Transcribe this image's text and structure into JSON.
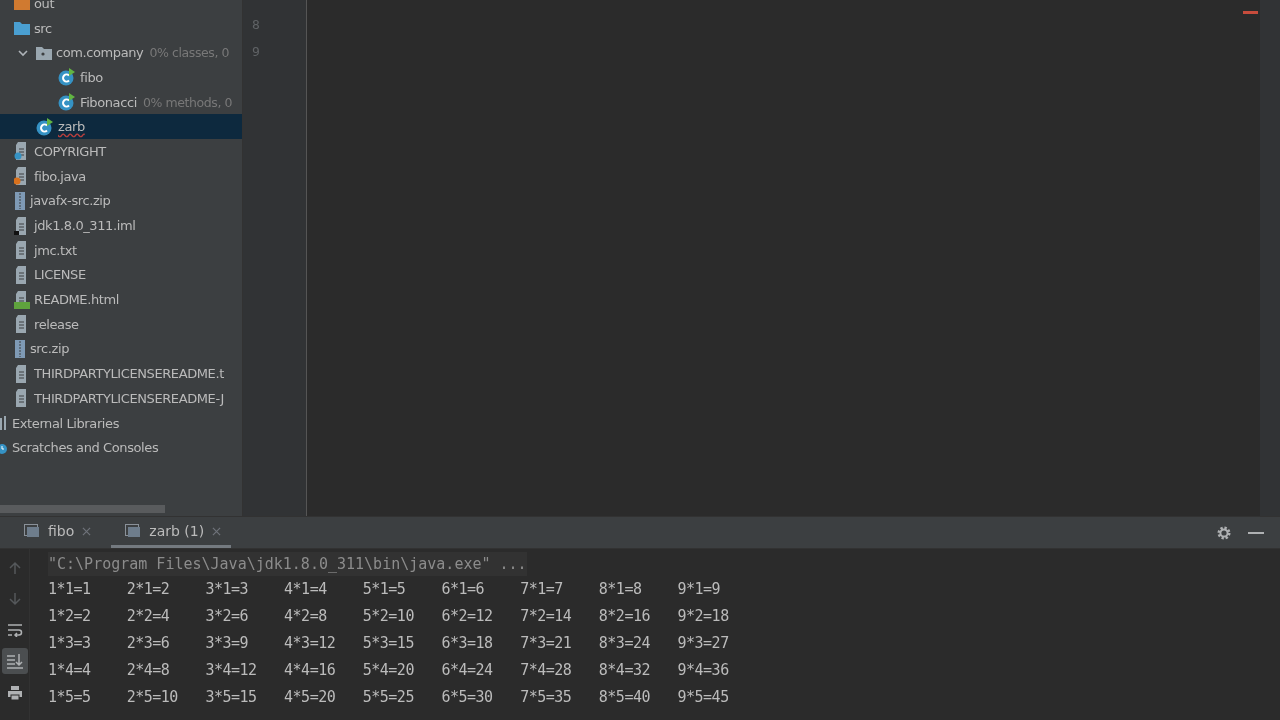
{
  "project_tree": {
    "items": [
      {
        "label": "out",
        "kind": "folder-orange",
        "selected": false
      },
      {
        "label": "src",
        "kind": "folder",
        "selected": false,
        "children": [
          {
            "label": "com.company",
            "kind": "package",
            "hint": "0% classes, 0",
            "expanded": true,
            "selected": false,
            "children": [
              {
                "label": "fibo",
                "kind": "class",
                "selected": false
              },
              {
                "label": "Fibonacci",
                "kind": "class",
                "hint": "0% methods, 0",
                "selected": false
              }
            ]
          },
          {
            "label": "zarb",
            "kind": "class",
            "selected": true
          }
        ]
      },
      {
        "label": "COPYRIGHT",
        "kind": "unknown-file",
        "selected": false
      },
      {
        "label": "fibo.java",
        "kind": "java-file",
        "selected": false
      },
      {
        "label": "javafx-src.zip",
        "kind": "zip",
        "selected": false
      },
      {
        "label": "jdk1.8.0_311.iml",
        "kind": "iml",
        "selected": false
      },
      {
        "label": "jmc.txt",
        "kind": "text",
        "selected": false
      },
      {
        "label": "LICENSE",
        "kind": "text",
        "selected": false
      },
      {
        "label": "README.html",
        "kind": "html",
        "selected": false
      },
      {
        "label": "release",
        "kind": "text",
        "selected": false
      },
      {
        "label": "src.zip",
        "kind": "zip",
        "selected": false
      },
      {
        "label": "THIRDPARTYLICENSEREADME.t",
        "kind": "text",
        "selected": false
      },
      {
        "label": "THIRDPARTYLICENSEREADME-J",
        "kind": "text",
        "selected": false
      }
    ],
    "roots": [
      {
        "label": "External Libraries",
        "kind": "libraries",
        "selected": false
      },
      {
        "label": "Scratches and Consoles",
        "kind": "scratches",
        "selected": false
      }
    ]
  },
  "editor": {
    "line_numbers": [
      "8",
      "9"
    ]
  },
  "run_panel": {
    "tabs": [
      {
        "label": "fibo",
        "selected": false
      },
      {
        "label": "zarb (1)",
        "selected": true
      }
    ],
    "command": "\"C:\\Program Files\\Java\\jdk1.8.0_311\\bin\\java.exe\" ...",
    "output": [
      [
        "1*1=1",
        "2*1=2",
        "3*1=3",
        "4*1=4",
        "5*1=5",
        "6*1=6",
        "7*1=7",
        "8*1=8",
        "9*1=9"
      ],
      [
        "1*2=2",
        "2*2=4",
        "3*2=6",
        "4*2=8",
        "5*2=10",
        "6*2=12",
        "7*2=14",
        "8*2=16",
        "9*2=18"
      ],
      [
        "1*3=3",
        "2*3=6",
        "3*3=9",
        "4*3=12",
        "5*3=15",
        "6*3=18",
        "7*3=21",
        "8*3=24",
        "9*3=27"
      ],
      [
        "1*4=4",
        "2*4=8",
        "3*4=12",
        "4*4=16",
        "5*4=20",
        "6*4=24",
        "7*4=28",
        "8*4=32",
        "9*4=36"
      ],
      [
        "1*5=5",
        "2*5=10",
        "3*5=15",
        "4*5=20",
        "5*5=25",
        "6*5=30",
        "7*5=35",
        "8*5=40",
        "9*5=45"
      ]
    ]
  }
}
